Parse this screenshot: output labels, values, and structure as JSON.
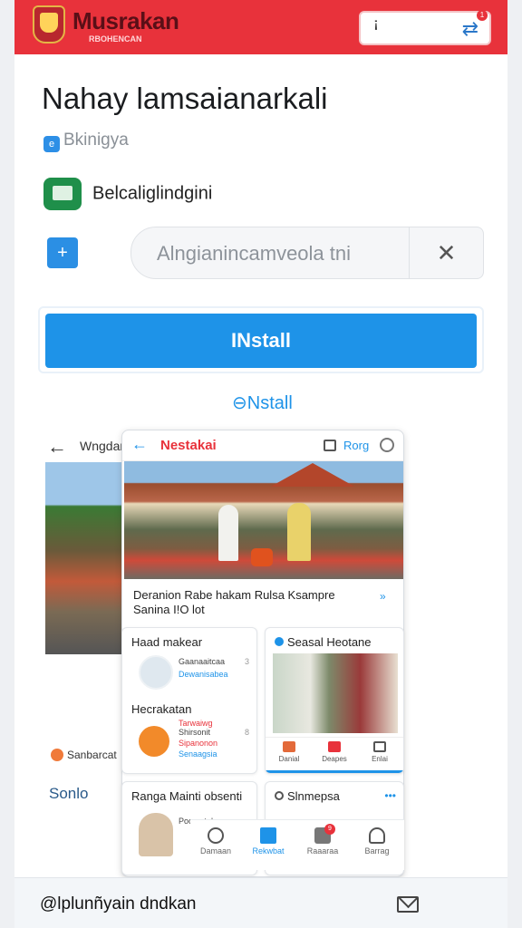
{
  "header": {
    "brand": "Musrakan",
    "brand_sub": "RBOHENCAN",
    "search_pin": "ꜟ",
    "search_icon": "share-icon",
    "badge": "1",
    "colors": {
      "bar": "#e8323b",
      "accent": "#1e93e8"
    }
  },
  "app": {
    "title": "Nahay lamsaianarkali",
    "tag": "Bkinigya",
    "developer": "Belcaliglindgini"
  },
  "search_field": {
    "value": "Alngianincamveola tni",
    "clear": "✕"
  },
  "install": {
    "button": "INstall",
    "link": "Nstall"
  },
  "screenshots": {
    "left": {
      "back": "←",
      "title": "Wngdar",
      "caption": "Sanbarcat",
      "footer": "Sonlo"
    },
    "phone": {
      "back": "←",
      "name": "Nestakai",
      "right": "Rorg",
      "post_title": "Deranion Rabe hakam Rulsa Ksampre",
      "post_sub": "Sanina I!O lot",
      "more": "»",
      "cards": {
        "c1": {
          "title": "Haad makear",
          "line1": "Gaanaaitcaa",
          "line2": "Dewanisabea",
          "title2": "Hecrakatan",
          "line3": "Tarwaiwg",
          "line4": "Shirsonit",
          "line5": "Sipanonon",
          "line6": "Senaagsia",
          "n1": "3",
          "n2": "8"
        },
        "c2": {
          "title": "Seasal Heotane",
          "tabs": [
            "Danial",
            "Deapes",
            "Enlai"
          ]
        },
        "c3": {
          "title": "Ranga Mainti obsenti",
          "line1": "Poomntakan"
        },
        "c4": {
          "title": "Slnmepsa",
          "dots": "•••"
        }
      },
      "nav": [
        "Damaan",
        "Rekwbat",
        "Raaaraa",
        "Barrag"
      ],
      "nav_badge": "9"
    }
  },
  "footer": {
    "text": "@lplunñyain dndkan",
    "icon": "mail-icon"
  }
}
